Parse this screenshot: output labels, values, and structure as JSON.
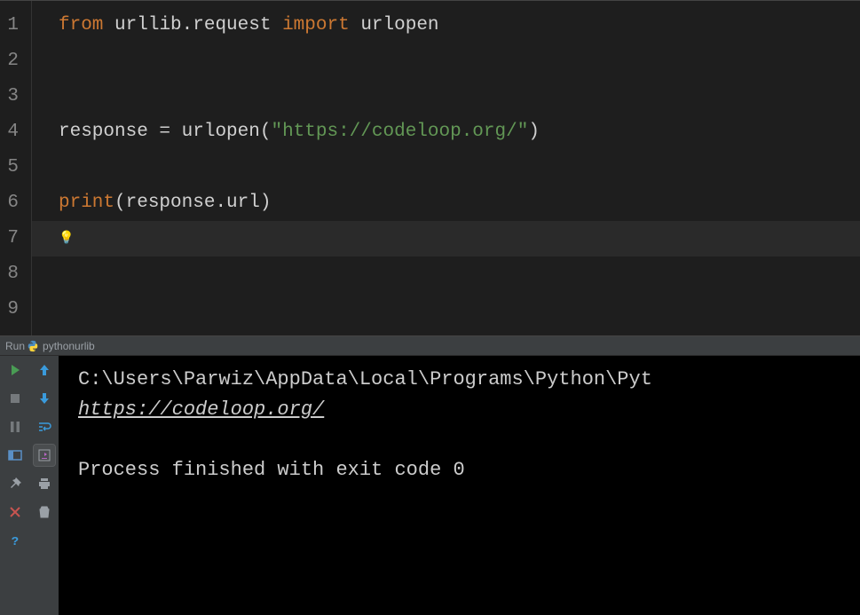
{
  "editor": {
    "lineNumbers": [
      "1",
      "2",
      "3",
      "4",
      "5",
      "6",
      "7",
      "8",
      "9"
    ],
    "code": {
      "l1": {
        "from": "from",
        "mod": "urllib.request",
        "import": "import",
        "name": "urlopen"
      },
      "l4": {
        "var": "response",
        "eq": " = ",
        "fn": "urlopen(",
        "str": "\"https://codeloop.org/\"",
        "close": ")"
      },
      "l6": {
        "print": "print",
        "open": "(",
        "expr": "response.url",
        "close": ")"
      },
      "bulb": "💡"
    },
    "currentLine": 7
  },
  "runHeader": {
    "label": "Run",
    "config": "pythonurlib"
  },
  "console": {
    "cmd": "C:\\Users\\Parwiz\\AppData\\Local\\Programs\\Python\\Pyt",
    "url": "https://codeloop.org/",
    "blank": "",
    "exit": "Process finished with exit code 0"
  },
  "tools": {
    "run": "run-icon",
    "stop": "stop-icon",
    "pause": "pause-icon",
    "layout": "layout-icon",
    "pin": "pin-icon",
    "close": "close-icon",
    "help": "help-icon",
    "up": "up-arrow-icon",
    "down": "down-arrow-icon",
    "wrap": "wrap-icon",
    "scroll": "scroll-to-end-icon",
    "print": "print-icon",
    "trash": "trash-icon"
  }
}
